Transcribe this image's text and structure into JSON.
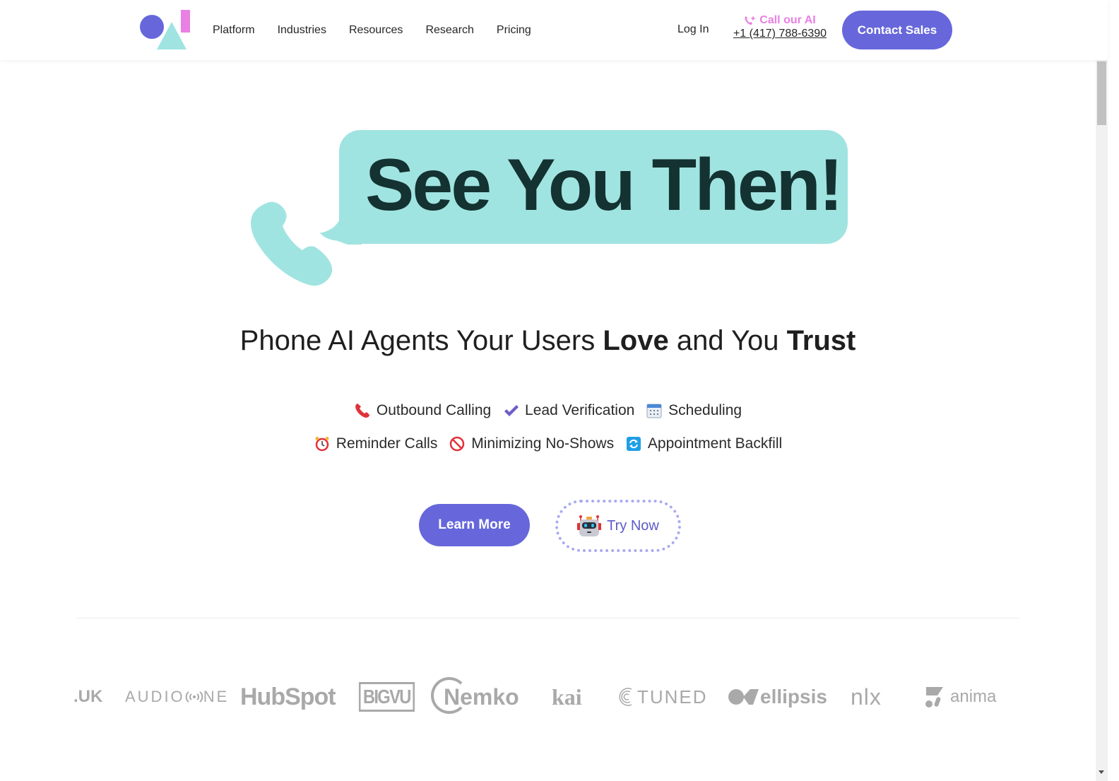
{
  "header": {
    "nav": [
      "Platform",
      "Industries",
      "Resources",
      "Research",
      "Pricing"
    ],
    "login": "Log In",
    "call_label": "Call our AI",
    "call_phone": "+1 (417) 788-6390",
    "contact_sales": "Contact Sales"
  },
  "hero": {
    "bubble_text": "See You Then!",
    "tagline": {
      "part1": "Phone AI Agents Your Users ",
      "bold1": "Love",
      "part2": " and You ",
      "bold2": "Trust"
    },
    "features": [
      {
        "icon": "telephone-receiver-icon",
        "label": "Outbound Calling"
      },
      {
        "icon": "check-mark-icon",
        "label": "Lead Verification"
      },
      {
        "icon": "calendar-icon",
        "label": "Scheduling"
      },
      {
        "icon": "alarm-clock-icon",
        "label": "Reminder Calls"
      },
      {
        "icon": "prohibited-icon",
        "label": "Minimizing No-Shows"
      },
      {
        "icon": "refresh-arrows-icon",
        "label": "Appointment Backfill"
      }
    ],
    "learn_more": "Learn More",
    "try_now": "Try Now"
  },
  "logos": {
    "items": [
      ".UK",
      "AUDIO",
      "NE",
      "HubSpot",
      "BIGVU",
      "Nemko",
      "kai",
      "TUNED",
      "ellipsis",
      "nlx",
      "anima"
    ]
  },
  "colors": {
    "brand_purple": "#6767db",
    "bubble_teal": "#a0e4e1",
    "bubble_text": "#143231",
    "call_pink": "#e980e3",
    "logo_gray": "#a9a9a9"
  }
}
